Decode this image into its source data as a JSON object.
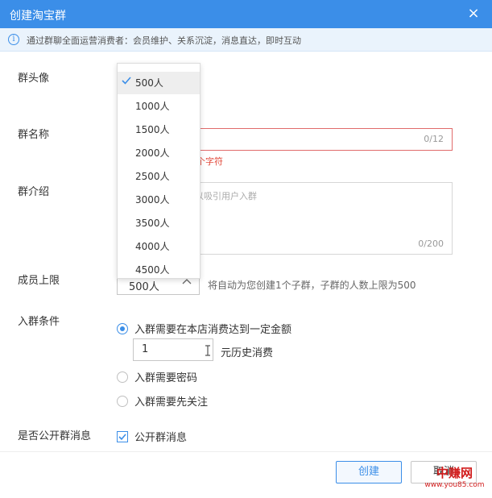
{
  "window": {
    "title": "创建淘宝群",
    "close_icon": "×"
  },
  "info": {
    "icon": "i",
    "text": "通过群聊全面运营消费者：会员维护、关系沉淀，消息直达，即时互动"
  },
  "form": {
    "avatar_label": "群头像",
    "name_label": "群名称",
    "name_counter": "0/12",
    "name_error": "字符，且必须大于两个字符",
    "intro_label": "群介绍",
    "intro_placeholder": "绍、特权和福利，以吸引用户入群",
    "intro_counter": "0/200",
    "limit_label": "成员上限",
    "limit_value": "500人",
    "limit_hint": "将自动为您创建1个子群，子群的人数上限为500",
    "condition_label": "入群条件",
    "conditions": [
      {
        "label": "入群需要在本店消费达到一定金额",
        "checked": true
      },
      {
        "label": "入群需要密码",
        "checked": false
      },
      {
        "label": "入群需要先关注",
        "checked": false
      }
    ],
    "amount_value": "1",
    "amount_unit": "元历史消费",
    "public_label": "是否公开群消息",
    "public_checkbox_label": "公开群消息",
    "public_checked": true
  },
  "dropdown": {
    "selected_index": 0,
    "options": [
      "500人",
      "1000人",
      "1500人",
      "2000人",
      "2500人",
      "3000人",
      "3500人",
      "4000人",
      "4500人"
    ]
  },
  "buttons": {
    "create": "创建",
    "cancel": "取消"
  },
  "watermark": {
    "main": "中赚网",
    "url": "www.you85.com"
  },
  "colors": {
    "accent": "#3b8ee8",
    "error": "#e24a3b",
    "watermark": "#d11b1b"
  }
}
